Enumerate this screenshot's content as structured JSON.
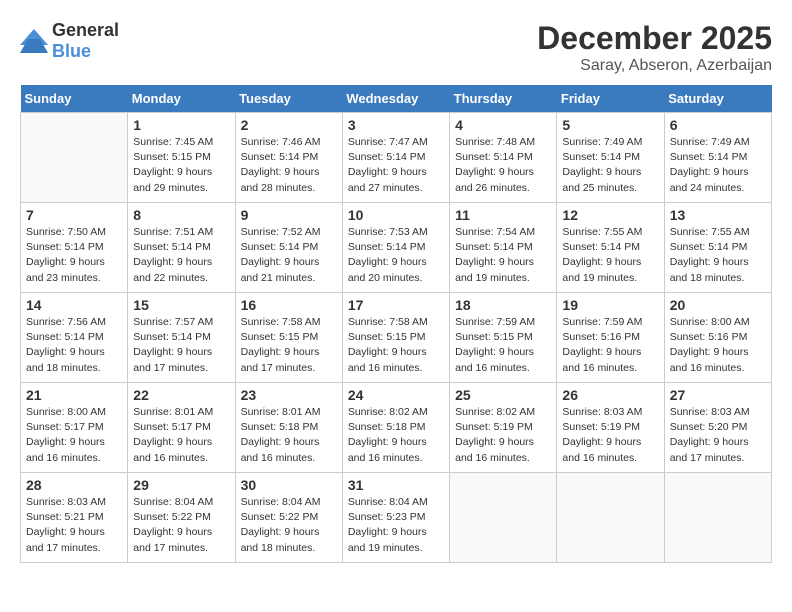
{
  "logo": {
    "general": "General",
    "blue": "Blue"
  },
  "title": {
    "month": "December 2025",
    "location": "Saray, Abseron, Azerbaijan"
  },
  "header": {
    "days": [
      "Sunday",
      "Monday",
      "Tuesday",
      "Wednesday",
      "Thursday",
      "Friday",
      "Saturday"
    ]
  },
  "weeks": [
    [
      {
        "day": "",
        "info": ""
      },
      {
        "day": "1",
        "info": "Sunrise: 7:45 AM\nSunset: 5:15 PM\nDaylight: 9 hours\nand 29 minutes."
      },
      {
        "day": "2",
        "info": "Sunrise: 7:46 AM\nSunset: 5:14 PM\nDaylight: 9 hours\nand 28 minutes."
      },
      {
        "day": "3",
        "info": "Sunrise: 7:47 AM\nSunset: 5:14 PM\nDaylight: 9 hours\nand 27 minutes."
      },
      {
        "day": "4",
        "info": "Sunrise: 7:48 AM\nSunset: 5:14 PM\nDaylight: 9 hours\nand 26 minutes."
      },
      {
        "day": "5",
        "info": "Sunrise: 7:49 AM\nSunset: 5:14 PM\nDaylight: 9 hours\nand 25 minutes."
      },
      {
        "day": "6",
        "info": "Sunrise: 7:49 AM\nSunset: 5:14 PM\nDaylight: 9 hours\nand 24 minutes."
      }
    ],
    [
      {
        "day": "7",
        "info": "Sunrise: 7:50 AM\nSunset: 5:14 PM\nDaylight: 9 hours\nand 23 minutes."
      },
      {
        "day": "8",
        "info": "Sunrise: 7:51 AM\nSunset: 5:14 PM\nDaylight: 9 hours\nand 22 minutes."
      },
      {
        "day": "9",
        "info": "Sunrise: 7:52 AM\nSunset: 5:14 PM\nDaylight: 9 hours\nand 21 minutes."
      },
      {
        "day": "10",
        "info": "Sunrise: 7:53 AM\nSunset: 5:14 PM\nDaylight: 9 hours\nand 20 minutes."
      },
      {
        "day": "11",
        "info": "Sunrise: 7:54 AM\nSunset: 5:14 PM\nDaylight: 9 hours\nand 19 minutes."
      },
      {
        "day": "12",
        "info": "Sunrise: 7:55 AM\nSunset: 5:14 PM\nDaylight: 9 hours\nand 19 minutes."
      },
      {
        "day": "13",
        "info": "Sunrise: 7:55 AM\nSunset: 5:14 PM\nDaylight: 9 hours\nand 18 minutes."
      }
    ],
    [
      {
        "day": "14",
        "info": "Sunrise: 7:56 AM\nSunset: 5:14 PM\nDaylight: 9 hours\nand 18 minutes."
      },
      {
        "day": "15",
        "info": "Sunrise: 7:57 AM\nSunset: 5:14 PM\nDaylight: 9 hours\nand 17 minutes."
      },
      {
        "day": "16",
        "info": "Sunrise: 7:58 AM\nSunset: 5:15 PM\nDaylight: 9 hours\nand 17 minutes."
      },
      {
        "day": "17",
        "info": "Sunrise: 7:58 AM\nSunset: 5:15 PM\nDaylight: 9 hours\nand 16 minutes."
      },
      {
        "day": "18",
        "info": "Sunrise: 7:59 AM\nSunset: 5:15 PM\nDaylight: 9 hours\nand 16 minutes."
      },
      {
        "day": "19",
        "info": "Sunrise: 7:59 AM\nSunset: 5:16 PM\nDaylight: 9 hours\nand 16 minutes."
      },
      {
        "day": "20",
        "info": "Sunrise: 8:00 AM\nSunset: 5:16 PM\nDaylight: 9 hours\nand 16 minutes."
      }
    ],
    [
      {
        "day": "21",
        "info": "Sunrise: 8:00 AM\nSunset: 5:17 PM\nDaylight: 9 hours\nand 16 minutes."
      },
      {
        "day": "22",
        "info": "Sunrise: 8:01 AM\nSunset: 5:17 PM\nDaylight: 9 hours\nand 16 minutes."
      },
      {
        "day": "23",
        "info": "Sunrise: 8:01 AM\nSunset: 5:18 PM\nDaylight: 9 hours\nand 16 minutes."
      },
      {
        "day": "24",
        "info": "Sunrise: 8:02 AM\nSunset: 5:18 PM\nDaylight: 9 hours\nand 16 minutes."
      },
      {
        "day": "25",
        "info": "Sunrise: 8:02 AM\nSunset: 5:19 PM\nDaylight: 9 hours\nand 16 minutes."
      },
      {
        "day": "26",
        "info": "Sunrise: 8:03 AM\nSunset: 5:19 PM\nDaylight: 9 hours\nand 16 minutes."
      },
      {
        "day": "27",
        "info": "Sunrise: 8:03 AM\nSunset: 5:20 PM\nDaylight: 9 hours\nand 17 minutes."
      }
    ],
    [
      {
        "day": "28",
        "info": "Sunrise: 8:03 AM\nSunset: 5:21 PM\nDaylight: 9 hours\nand 17 minutes."
      },
      {
        "day": "29",
        "info": "Sunrise: 8:04 AM\nSunset: 5:22 PM\nDaylight: 9 hours\nand 17 minutes."
      },
      {
        "day": "30",
        "info": "Sunrise: 8:04 AM\nSunset: 5:22 PM\nDaylight: 9 hours\nand 18 minutes."
      },
      {
        "day": "31",
        "info": "Sunrise: 8:04 AM\nSunset: 5:23 PM\nDaylight: 9 hours\nand 19 minutes."
      },
      {
        "day": "",
        "info": ""
      },
      {
        "day": "",
        "info": ""
      },
      {
        "day": "",
        "info": ""
      }
    ]
  ]
}
